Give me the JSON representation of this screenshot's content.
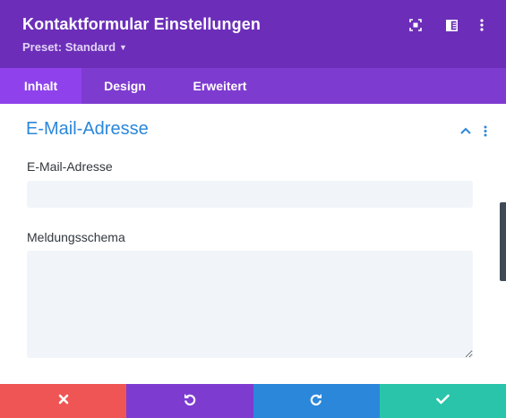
{
  "header": {
    "title": "Kontaktformular Einstellungen",
    "preset_label": "Preset: Standard",
    "icons": [
      "focus-icon",
      "split-view-icon",
      "more-vertical-icon"
    ]
  },
  "tabs": [
    {
      "label": "Inhalt",
      "active": true
    },
    {
      "label": "Design",
      "active": false
    },
    {
      "label": "Erweitert",
      "active": false
    }
  ],
  "section": {
    "title": "E-Mail-Adresse",
    "fields": [
      {
        "label": "E-Mail-Adresse",
        "value": "",
        "placeholder": ""
      },
      {
        "label": "Meldungsschema",
        "value": "",
        "placeholder": ""
      }
    ]
  },
  "footer": {
    "buttons": [
      {
        "name": "cancel",
        "icon": "close-icon",
        "color": "#ef5555"
      },
      {
        "name": "undo",
        "icon": "undo-icon",
        "color": "#7e3bd0"
      },
      {
        "name": "redo",
        "icon": "redo-icon",
        "color": "#2b87da"
      },
      {
        "name": "save",
        "icon": "check-icon",
        "color": "#29c4a9"
      }
    ]
  },
  "colors": {
    "header_bg": "#6c2eb9",
    "tabs_bg": "#7e3bd0",
    "active_tab_bg": "#8f42ec",
    "section_title": "#2b87da",
    "input_bg": "#f1f5f9"
  }
}
